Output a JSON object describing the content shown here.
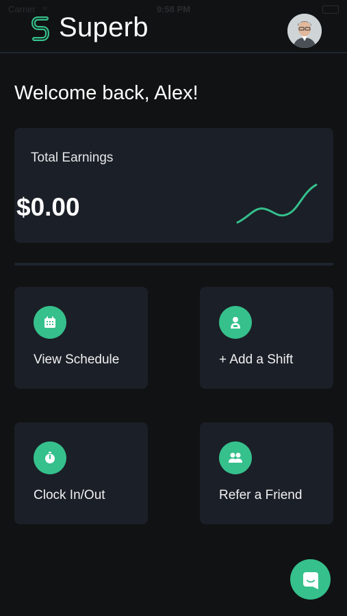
{
  "status_bar": {
    "carrier": "Carrier",
    "time": "9:58 PM"
  },
  "header": {
    "brand": "Superb",
    "avatar_icon": "user-avatar"
  },
  "welcome": "Welcome back, Alex!",
  "earnings": {
    "label": "Total Earnings",
    "value": "$0.00",
    "trend_icon": "sparkline"
  },
  "tiles": [
    {
      "label": "View Schedule",
      "icon": "calendar-icon"
    },
    {
      "label": "+ Add a Shift",
      "icon": "add-shift-icon"
    },
    {
      "label": "Clock In/Out",
      "icon": "stopwatch-icon"
    },
    {
      "label": "Refer a Friend",
      "icon": "people-icon"
    }
  ],
  "colors": {
    "background": "#111213",
    "card": "#1b1f27",
    "accent": "#35c08c"
  },
  "chat": {
    "icon": "chat-icon"
  }
}
